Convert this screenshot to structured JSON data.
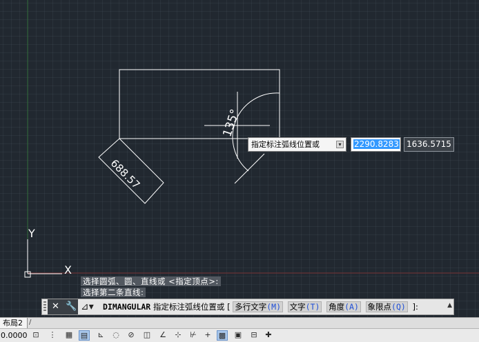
{
  "drawing": {
    "angle_dimension": "135°",
    "linear_dimension": "688.57",
    "ucs_y_label": "Y",
    "ucs_x_label": "X"
  },
  "dynamic_input": {
    "prompt": "指定标注弧线位置或",
    "x_value": "2290.8283",
    "y_value": "1636.5715"
  },
  "command_history": [
    "选择圆弧、圆、直线或 <指定顶点>:",
    "选择第二条直线:"
  ],
  "command_line": {
    "command": "DIMANGULAR",
    "prompt": "指定标注弧线位置或",
    "options": [
      {
        "label": "多行文字",
        "key": "(M)"
      },
      {
        "label": "文字",
        "key": "(T)"
      },
      {
        "label": "角度",
        "key": "(A)"
      },
      {
        "label": "象限点",
        "key": "(Q)"
      }
    ],
    "tail": "]:"
  },
  "layout_tabs": [
    "布局2"
  ],
  "status_bar": {
    "coordinates": "0.0000",
    "icons": [
      "infer-constraints-icon",
      "snap-icon",
      "grid-icon",
      "ortho-icon",
      "polar-icon",
      "osnap-icon",
      "3dosnap-icon",
      "otrack-icon",
      "ducs-icon",
      "dyn-icon",
      "lineweight-icon",
      "transparency-icon",
      "quick-properties-icon",
      "selection-cycling-icon",
      "annotation-monitor-icon"
    ]
  }
}
